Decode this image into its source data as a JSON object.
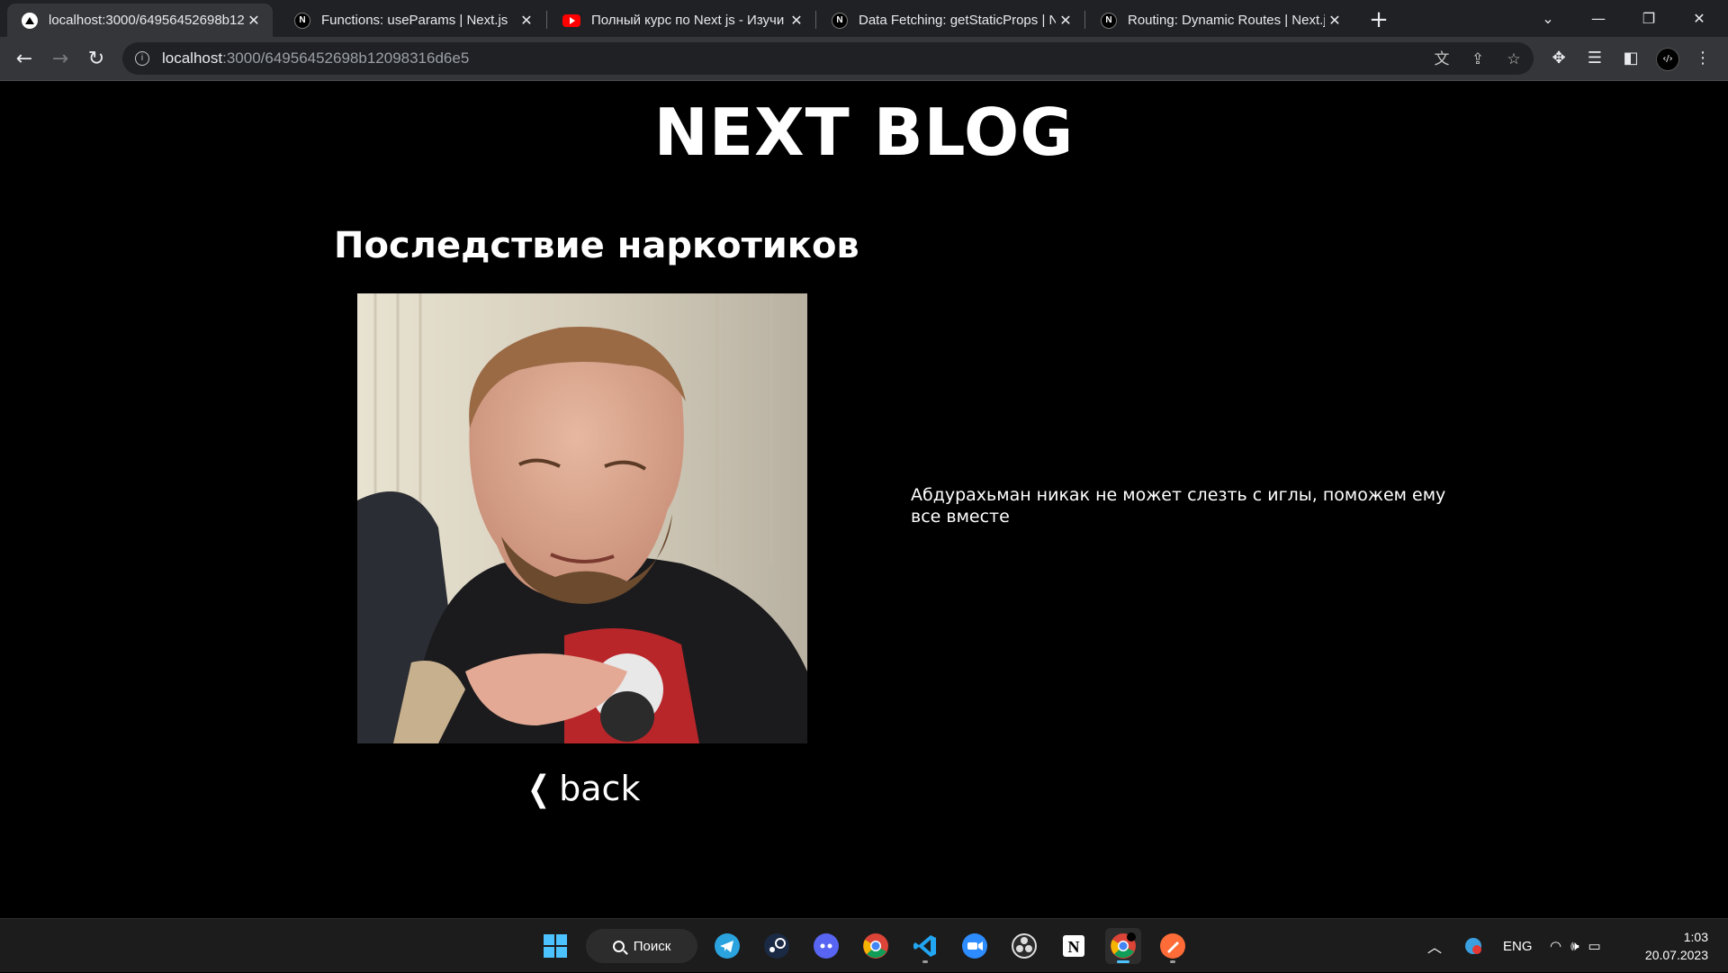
{
  "browser": {
    "tabs": [
      {
        "title": "localhost:3000/64956452698b12",
        "favicon": "vercel-icon",
        "active": true
      },
      {
        "title": "Functions: useParams | Next.js",
        "favicon": "nextjs-icon",
        "active": false
      },
      {
        "title": "Полный курс по Next js - Изучи",
        "favicon": "youtube-icon",
        "active": false
      },
      {
        "title": "Data Fetching: getStaticProps | N",
        "favicon": "nextjs-icon",
        "active": false
      },
      {
        "title": "Routing: Dynamic Routes | Next.js",
        "favicon": "nextjs-icon",
        "active": false
      }
    ],
    "address": {
      "host": "localhost",
      "path": ":3000/64956452698b12098316d6e5"
    }
  },
  "page": {
    "site_title": "NEXT BLOG",
    "post_title": "Последствие наркотиков",
    "post_body": "Абдурахьман никак не может слезть с иглы, поможем ему все вместе",
    "back_label": "back"
  },
  "taskbar": {
    "search_label": "Поиск",
    "language": "ENG",
    "time": "1:03",
    "date": "20.07.2023",
    "apps": [
      "windows-start-icon",
      "telegram-icon",
      "steam-icon",
      "discord-icon",
      "chrome-icon",
      "vscode-icon",
      "zoom-icon",
      "obs-icon",
      "notion-icon",
      "chrome-dev-icon",
      "postman-icon"
    ]
  },
  "colors": {
    "page_background": "#000000",
    "tabstrip": "#202124",
    "toolbar": "#35363a",
    "taskbar": "#1c1c1c"
  }
}
